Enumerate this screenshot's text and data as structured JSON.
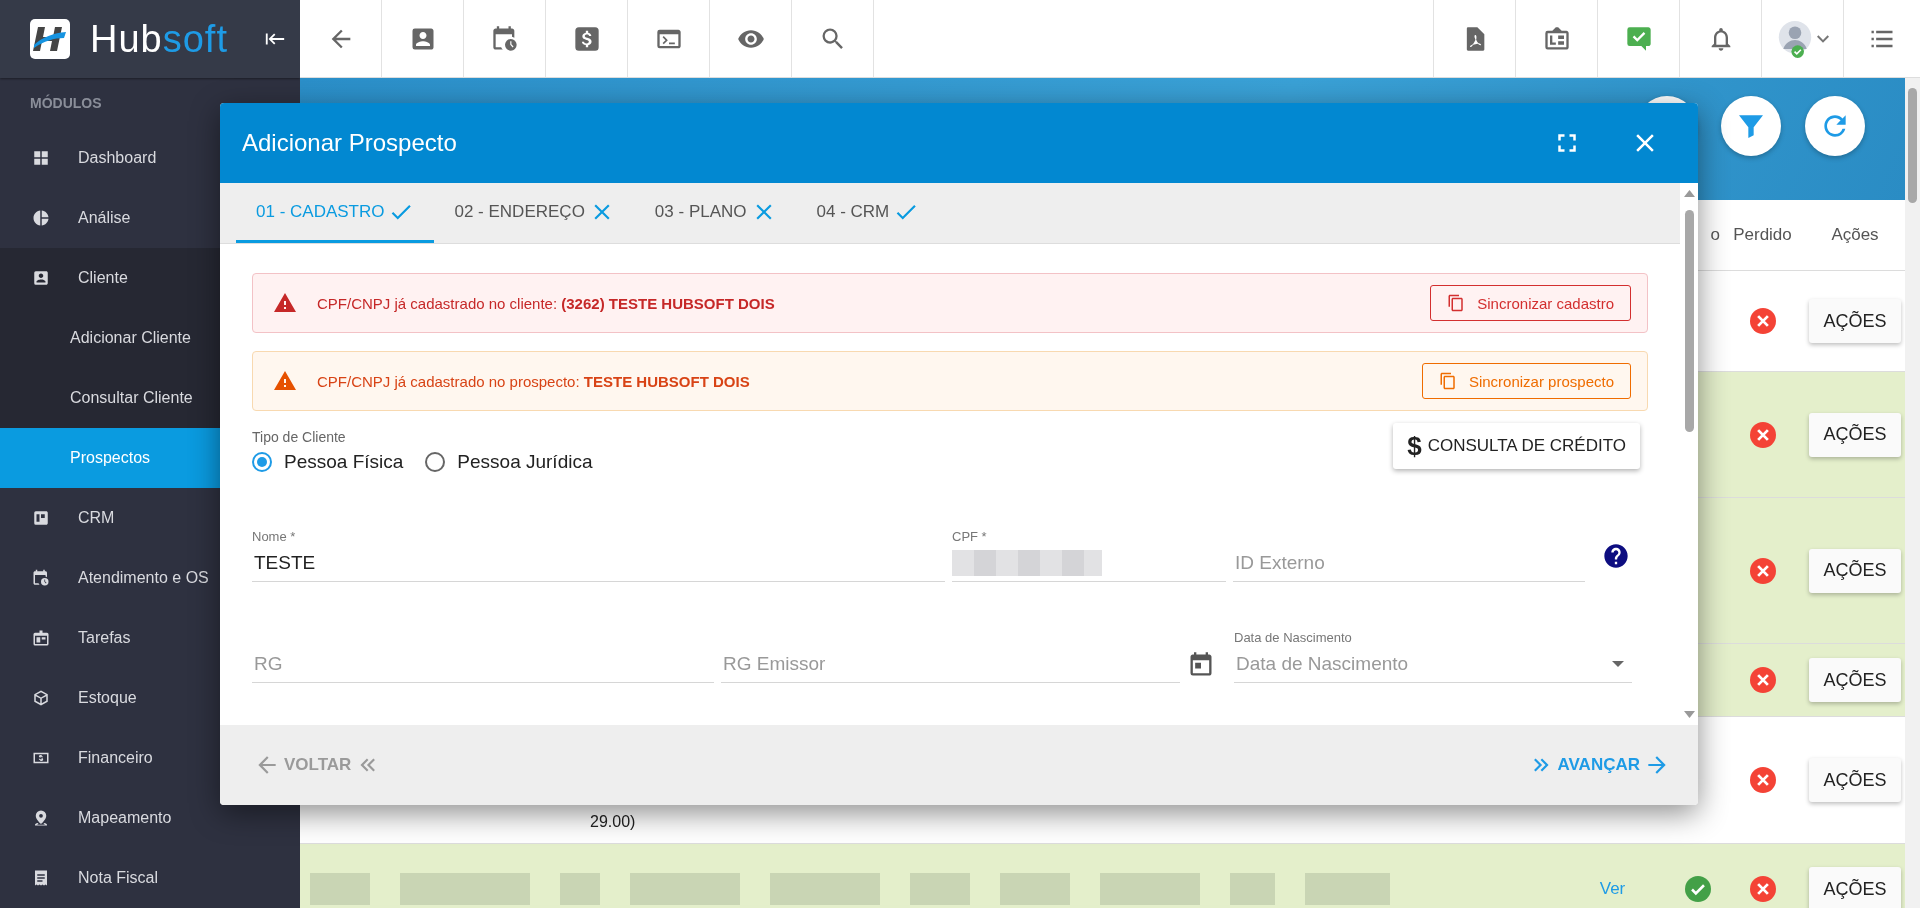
{
  "sidebar": {
    "logo_parts": [
      "Hub",
      "soft"
    ],
    "section_title": "MÓDULOS",
    "items": [
      {
        "label": "Dashboard",
        "selected": false
      },
      {
        "label": "Análise",
        "selected": false
      },
      {
        "label": "Cliente",
        "selected": false,
        "expanded": true,
        "children": [
          {
            "label": "Adicionar Cliente",
            "selected": false
          },
          {
            "label": "Consultar Cliente",
            "selected": false
          },
          {
            "label": "Prospectos",
            "selected": true
          }
        ]
      },
      {
        "label": "CRM",
        "selected": false
      },
      {
        "label": "Atendimento e OS",
        "selected": false
      },
      {
        "label": "Tarefas",
        "selected": false
      },
      {
        "label": "Estoque",
        "selected": false
      },
      {
        "label": "Financeiro",
        "selected": false
      },
      {
        "label": "Mapeamento",
        "selected": false
      },
      {
        "label": "Nota Fiscal",
        "selected": false
      }
    ]
  },
  "table": {
    "columns": [
      "o",
      "Perdido",
      "Ações"
    ],
    "rows": [
      {
        "highlighted": false,
        "won": false,
        "lost": true,
        "action": "AÇÕES"
      },
      {
        "highlighted": true,
        "won": false,
        "lost": true,
        "action": "AÇÕES"
      },
      {
        "highlighted": true,
        "won": false,
        "lost": true,
        "action": "AÇÕES"
      },
      {
        "highlighted": true,
        "won": false,
        "lost": true,
        "action": "AÇÕES"
      },
      {
        "highlighted": false,
        "won": false,
        "lost": true,
        "action": "AÇÕES",
        "note": "29.00)"
      },
      {
        "highlighted": true,
        "won": true,
        "lost": true,
        "action": "AÇÕES",
        "link": "Ver"
      }
    ]
  },
  "modal": {
    "title": "Adicionar Prospecto",
    "tabs": [
      {
        "label": "01 - CADASTRO",
        "valid": true,
        "selected": true
      },
      {
        "label": "02 - ENDEREÇO",
        "valid": false,
        "selected": false
      },
      {
        "label": "03 - PLANO",
        "valid": false,
        "selected": false
      },
      {
        "label": "04 - CRM",
        "valid": true,
        "selected": false
      }
    ],
    "alerts": [
      {
        "kind": "error",
        "text": "CPF/CNPJ já cadastrado no cliente: **(3262) TESTE HUBSOFT DOIS**",
        "button": "Sincronizar cadastro"
      },
      {
        "kind": "warning",
        "text": "CPF/CNPJ já cadastrado no prospecto: **TESTE HUBSOFT DOIS**",
        "button": "Sincronizar prospecto"
      }
    ],
    "client_type": {
      "label": "Tipo de Cliente",
      "options": [
        {
          "label": "Pessoa Física",
          "selected": true
        },
        {
          "label": "Pessoa Jurídica",
          "selected": false
        }
      ]
    },
    "credit_button": {
      "symbol": "$",
      "label": "CONSULTA DE CRÉDITO"
    },
    "field_rows": [
      [
        {
          "kind": "text",
          "label": "Nome *",
          "value": "TESTE"
        },
        {
          "kind": "redacted",
          "label": "CPF *"
        },
        {
          "kind": "text",
          "placeholder": "ID Externo",
          "help": true
        }
      ],
      [
        {
          "kind": "text",
          "placeholder": "RG"
        },
        {
          "kind": "text",
          "placeholder": "RG Emissor"
        },
        {
          "kind": "date",
          "label": "Data de Nascimento",
          "placeholder": "Data de Nascimento"
        }
      ]
    ],
    "back": {
      "label": "VOLTAR",
      "disabled": true
    },
    "next": {
      "label": "AVANÇAR",
      "disabled": false
    }
  }
}
